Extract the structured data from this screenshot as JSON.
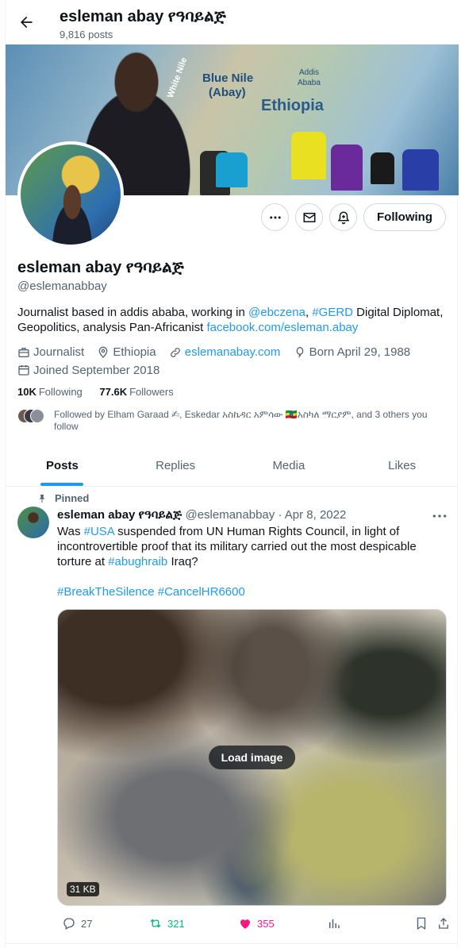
{
  "header": {
    "title": "esleman abay የዓባይልጅ",
    "post_count": "9,816 posts"
  },
  "banner": {
    "map_label_1": "Blue Nile",
    "map_label_2": "(Abay)",
    "map_label_3": "Ethiopia",
    "map_label_4": "Addis",
    "map_label_5": "Ababa",
    "map_label_6": "White Nile"
  },
  "actions": {
    "follow_label": "Following"
  },
  "profile": {
    "name": "esleman abay የዓባይልጅ",
    "handle": "@eslemanabbay",
    "bio_1": "Journalist based in addis ababa, working in ",
    "bio_mention": "@ebczena",
    "bio_2": ", ",
    "bio_hashtag": "#GERD",
    "bio_3": " Digital Diplomat, Geopolitics, analysis Pan-Africanist ",
    "bio_link": "facebook.com/esleman.abay",
    "category": "Journalist",
    "location": "Ethiopia",
    "website": "eslemanabay.com",
    "birthday": "Born April 29, 1988",
    "joined": "Joined September 2018",
    "following_count": "10K",
    "following_label": "Following",
    "followers_count": "77.6K",
    "followers_label": "Followers",
    "followed_by": "Followed by Elham Garaad ✍, Eskedar አስኬዳር አምሳው 🇪🇹አስካለ ማርያም, and 3 others you follow"
  },
  "tabs": [
    "Posts",
    "Replies",
    "Media",
    "Likes"
  ],
  "post": {
    "pinned_label": "Pinned",
    "author": "esleman abay የዓባይልጅ",
    "handle": "@eslemanabbay",
    "separator": "·",
    "date": "Apr 8, 2022",
    "text_1": "Was ",
    "hashtag_usa": "#USA",
    "text_2": " suspended from UN Human Rights Council, in light of incontrovertible proof that its military carried out the most despicable torture at ",
    "hashtag_abu": "#abughraib",
    "text_3": " Iraq?",
    "hashtag_break": "#BreakTheSilence",
    "hashtag_cancel": "#CancelHR6600",
    "load_image_label": "Load image",
    "image_size": "31 KB",
    "replies": "27",
    "reposts": "321",
    "likes": "355"
  },
  "colors": {
    "accent": "#1d9bf0",
    "repost": "#00ba7c",
    "like": "#f91880",
    "muted": "#536471"
  }
}
